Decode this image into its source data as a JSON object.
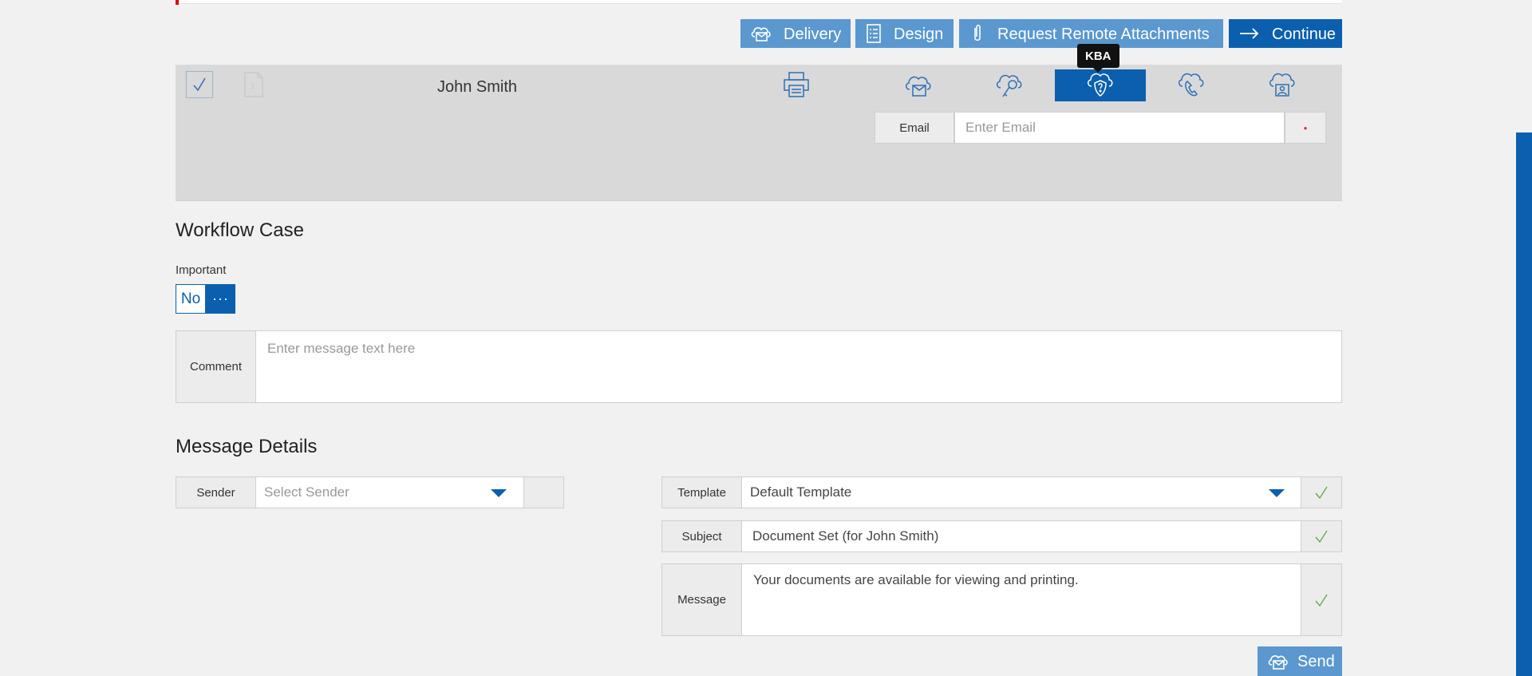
{
  "toolbar": {
    "delivery_label": "Delivery",
    "design_label": "Design",
    "attachments_label": "Request Remote Attachments",
    "continue_label": "Continue"
  },
  "signer": {
    "name": "John Smith",
    "doc_count": "1",
    "tooltip": "KBA",
    "email_label": "Email",
    "email_placeholder": "Enter Email",
    "required_mark": "•"
  },
  "workflow": {
    "title": "Workflow Case",
    "important_label": "Important",
    "important_value": "No",
    "more_label": "···",
    "comment_label": "Comment",
    "comment_placeholder": "Enter message text here"
  },
  "message_details": {
    "title": "Message Details",
    "sender_label": "Sender",
    "sender_placeholder": "Select Sender",
    "template_label": "Template",
    "template_value": "Default Template",
    "subject_label": "Subject",
    "subject_value": "Document Set (for John Smith)",
    "message_label": "Message",
    "message_value": "Your documents are available for viewing and printing.",
    "send_label": "Send",
    "check_mark": "✓"
  },
  "colors": {
    "primary": "#0b5fae",
    "button_light": "#5a98cf",
    "panel": "#d9d9d9",
    "background": "#f1f1f1",
    "required": "#e03030",
    "check": "#6aa84f"
  },
  "icons": [
    "cloud-envelope-icon",
    "document-list-icon",
    "paperclip-icon",
    "arrow-right-icon",
    "checkbox-icon",
    "document-icon",
    "printer-icon",
    "cloud-key-icon",
    "cloud-question-shield-icon",
    "cloud-phone-icon",
    "cloud-id-card-icon",
    "dropdown-caret-icon",
    "check-icon"
  ]
}
